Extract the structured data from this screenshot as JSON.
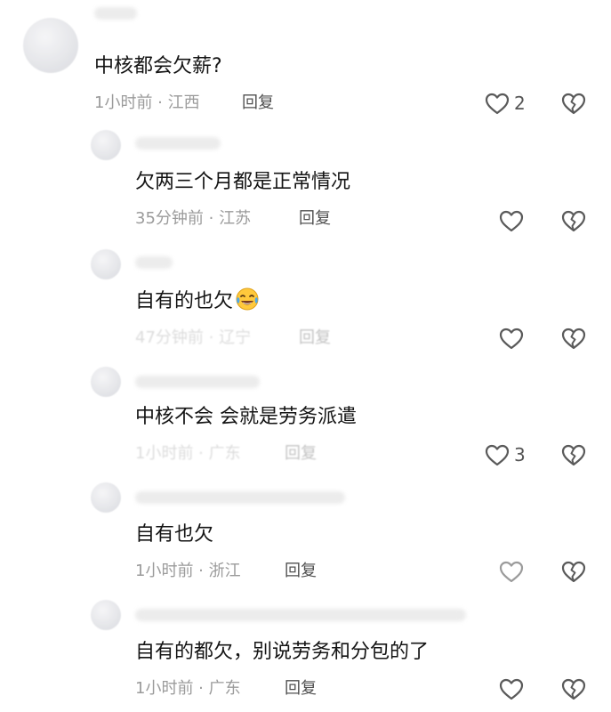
{
  "comments": [
    {
      "text": "中核都会欠薪?",
      "time": "1小时前",
      "location": "江西",
      "reply_label": "回复",
      "likes": "2"
    },
    {
      "text": "欠两三个月都是正常情况",
      "time": "35分钟前",
      "location": "江苏",
      "reply_label": "回复",
      "likes": ""
    },
    {
      "text": "自有的也欠",
      "emoji": "crying-laughing-emoji",
      "time": "47分钟前",
      "location": "辽宁",
      "reply_label": "回复",
      "likes": ""
    },
    {
      "text": "中核不会  会就是劳务派遣",
      "time": "1小时前",
      "location": "广东",
      "reply_label": "回复",
      "likes": "3"
    },
    {
      "text": "自有也欠",
      "time": "1小时前",
      "location": "浙江",
      "reply_label": "回复",
      "likes": ""
    },
    {
      "text": "自有的都欠，别说劳务和分包的了",
      "time": "1小时前",
      "location": "广东",
      "reply_label": "回复",
      "likes": ""
    }
  ],
  "icons": {
    "like": "heart-outline-icon",
    "dislike": "broken-heart-icon"
  },
  "colors": {
    "text": "#141414",
    "meta": "#9b9b9b",
    "icon": "#5a5a5a"
  }
}
